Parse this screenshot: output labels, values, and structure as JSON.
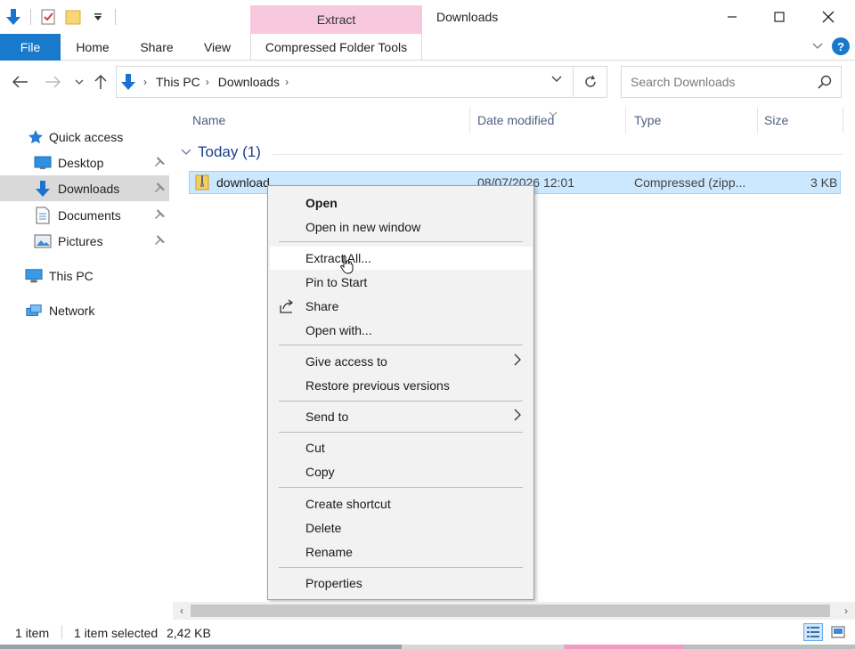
{
  "window": {
    "title": "Downloads"
  },
  "contextual_tab": {
    "header": "Extract",
    "tab": "Compressed Folder Tools"
  },
  "ribbon": {
    "tabs": [
      "File",
      "Home",
      "Share",
      "View"
    ],
    "help": "?"
  },
  "address": {
    "crumbs": [
      "This PC",
      "Downloads"
    ]
  },
  "search": {
    "placeholder": "Search Downloads"
  },
  "sidebar": {
    "items": [
      {
        "label": "Quick access",
        "icon": "star-icon"
      },
      {
        "label": "Desktop",
        "icon": "desktop-icon",
        "pinned": true
      },
      {
        "label": "Downloads",
        "icon": "download-arrow-icon",
        "pinned": true,
        "selected": true
      },
      {
        "label": "Documents",
        "icon": "document-icon",
        "pinned": true
      },
      {
        "label": "Pictures",
        "icon": "pictures-icon",
        "pinned": true
      },
      {
        "label": "This PC",
        "icon": "computer-icon"
      },
      {
        "label": "Network",
        "icon": "network-icon"
      }
    ]
  },
  "columns": {
    "name": "Name",
    "date": "Date modified",
    "type": "Type",
    "size": "Size"
  },
  "group": {
    "label": "Today (1)"
  },
  "file": {
    "name": "download",
    "date": "08/07/2026 12:01",
    "type": "Compressed (zipp...",
    "size": "3 KB"
  },
  "context_menu": {
    "open": "Open",
    "open_new_window": "Open in new window",
    "extract_all": "Extract All...",
    "pin_to_start": "Pin to Start",
    "share": "Share",
    "open_with": "Open with...",
    "give_access": "Give access to",
    "restore_versions": "Restore previous versions",
    "send_to": "Send to",
    "cut": "Cut",
    "copy": "Copy",
    "create_shortcut": "Create shortcut",
    "delete": "Delete",
    "rename": "Rename",
    "properties": "Properties"
  },
  "status": {
    "item_count": "1 item",
    "selected": "1 item selected",
    "selected_size": "2,42 KB"
  },
  "colors": {
    "accent": "#1979ca",
    "contextual": "#f8c8de",
    "selection": "#cce8ff"
  }
}
